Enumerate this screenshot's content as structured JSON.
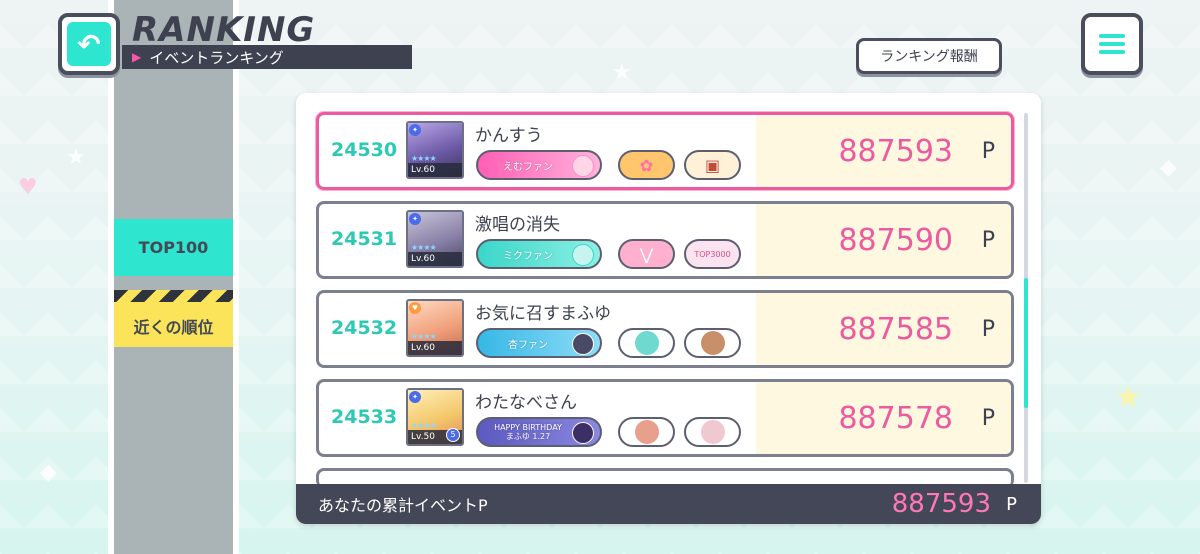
{
  "header": {
    "title": "RANKING",
    "subtitle": "イベントランキング",
    "reward_button": "ランキング報酬",
    "back_icon": "back-arrow-icon",
    "menu_icon": "menu-icon"
  },
  "sidebar": {
    "tabs": [
      {
        "label": "TOP100",
        "color": "#2ee5d0"
      },
      {
        "label": "近くの順位",
        "color": "#fbe35a",
        "selected": true
      }
    ]
  },
  "colors": {
    "accent": "#2ee5d0",
    "score": "#ee5aa0",
    "frame": "#4a4e5c",
    "highlight_border": "#ee5aa0"
  },
  "rankings": [
    {
      "rank": "24530",
      "name": "かんすう",
      "level": "Lv.60",
      "main_honor": "えむファン",
      "main_honor_color": "#ff7cc4",
      "sub_honors": [
        {
          "color": "#ffd07a"
        },
        {
          "color": "#fff0d8"
        }
      ],
      "score": "887593",
      "unit": "P",
      "mine": true
    },
    {
      "rank": "24531",
      "name": "激唱の消失",
      "level": "Lv.60",
      "main_honor": "ミクファン",
      "main_honor_color": "#4ee0d0",
      "sub_honors": [
        {
          "color": "#ffa3c6"
        },
        {
          "color": "#fbe3ef",
          "text": "TOP3000"
        }
      ],
      "score": "887590",
      "unit": "P",
      "mine": false
    },
    {
      "rank": "24532",
      "name": "お気に召すまふゆ",
      "level": "Lv.60",
      "main_honor": "杏ファン",
      "main_honor_color": "#50c8ee",
      "sub_honors": [
        {
          "color": "#ffffff"
        },
        {
          "color": "#ffffff"
        }
      ],
      "score": "887585",
      "unit": "P",
      "mine": false
    },
    {
      "rank": "24533",
      "name": "わたなべさん",
      "level": "Lv.50",
      "master_rank": "5",
      "main_honor": "HAPPY BIRTHDAY まふゆ 1.27",
      "main_honor_color": "#6a66c8",
      "sub_honors": [
        {
          "color": "#ffffff"
        },
        {
          "color": "#ffffff"
        }
      ],
      "score": "887578",
      "unit": "P",
      "mine": false
    }
  ],
  "footer": {
    "label": "あなたの累計イベントP",
    "value": "887593",
    "unit": "P"
  }
}
